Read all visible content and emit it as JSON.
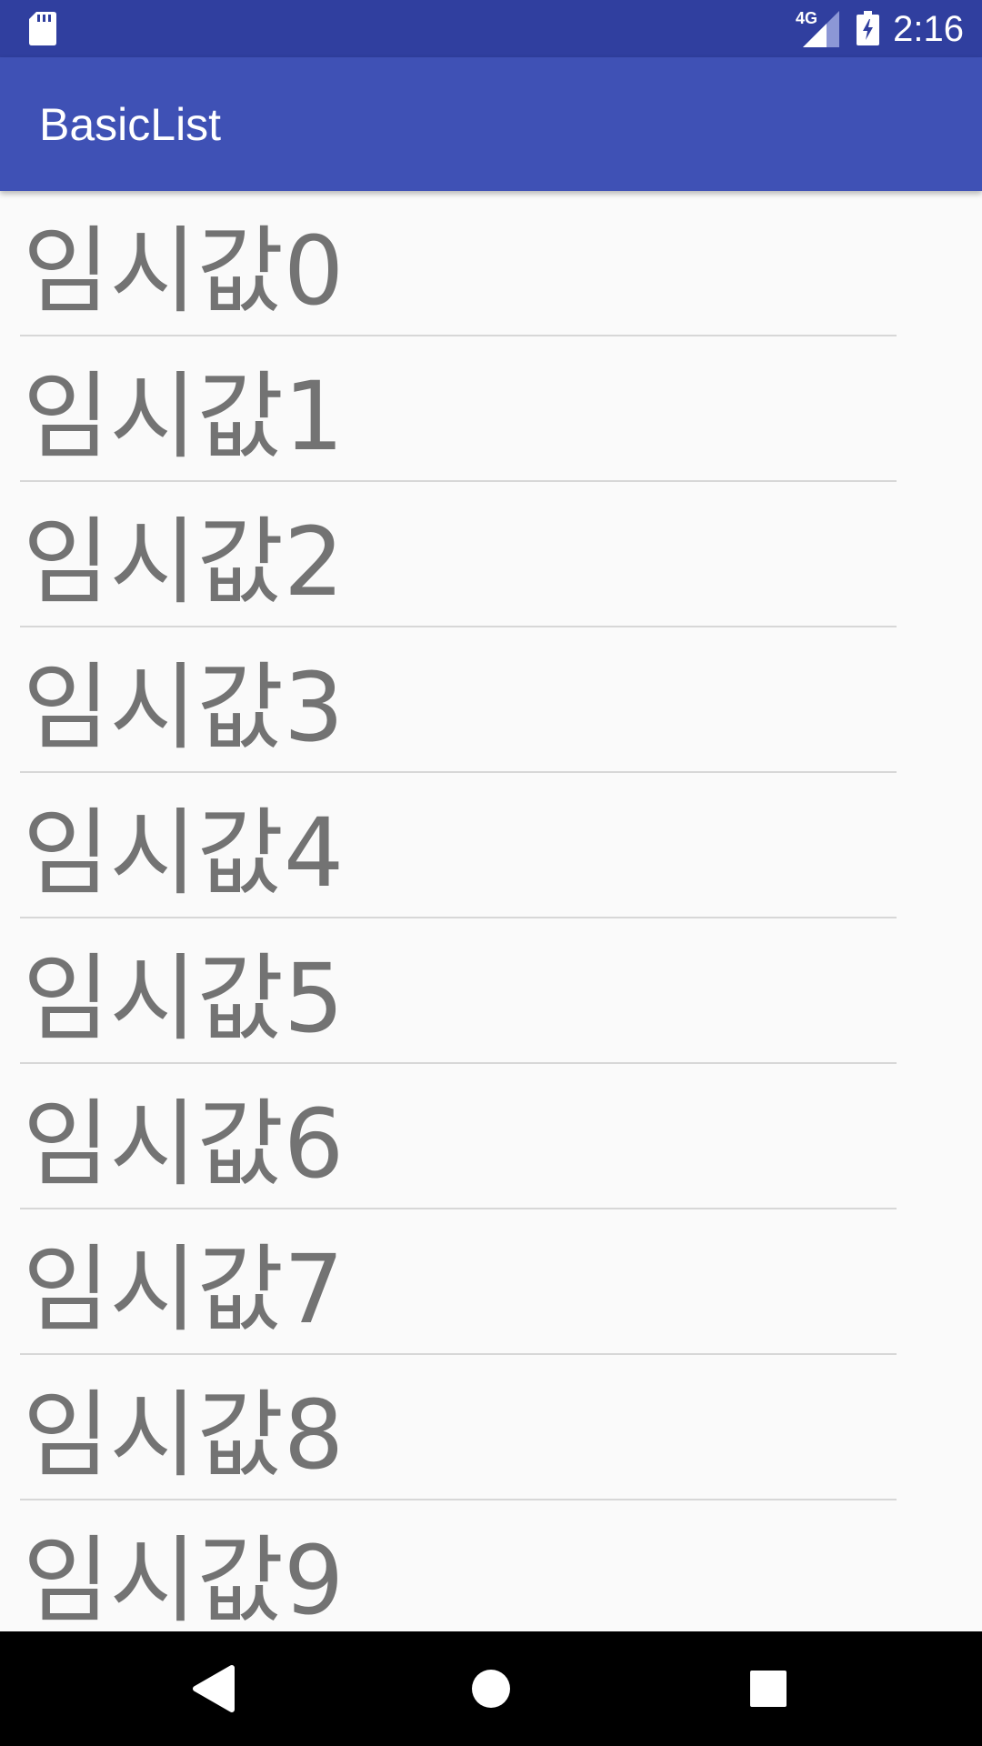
{
  "status_bar": {
    "network_label": "4G",
    "clock": "2:16",
    "icons": [
      "sd-card-icon",
      "signal-icon",
      "battery-charging-icon"
    ]
  },
  "app_bar": {
    "title": "BasicList"
  },
  "list": {
    "items": [
      {
        "label": "임시값0"
      },
      {
        "label": "임시값1"
      },
      {
        "label": "임시값2"
      },
      {
        "label": "임시값3"
      },
      {
        "label": "임시값4"
      },
      {
        "label": "임시값5"
      },
      {
        "label": "임시값6"
      },
      {
        "label": "임시값7"
      },
      {
        "label": "임시값8"
      },
      {
        "label": "임시값9"
      }
    ]
  },
  "nav_bar": {
    "icons": [
      "back-icon",
      "home-icon",
      "recents-icon"
    ]
  },
  "colors": {
    "status_bar": "#303f9f",
    "app_bar": "#3f51b5",
    "list_background": "#fafafa",
    "item_text": "#737373",
    "divider": "#d7d7d7"
  }
}
